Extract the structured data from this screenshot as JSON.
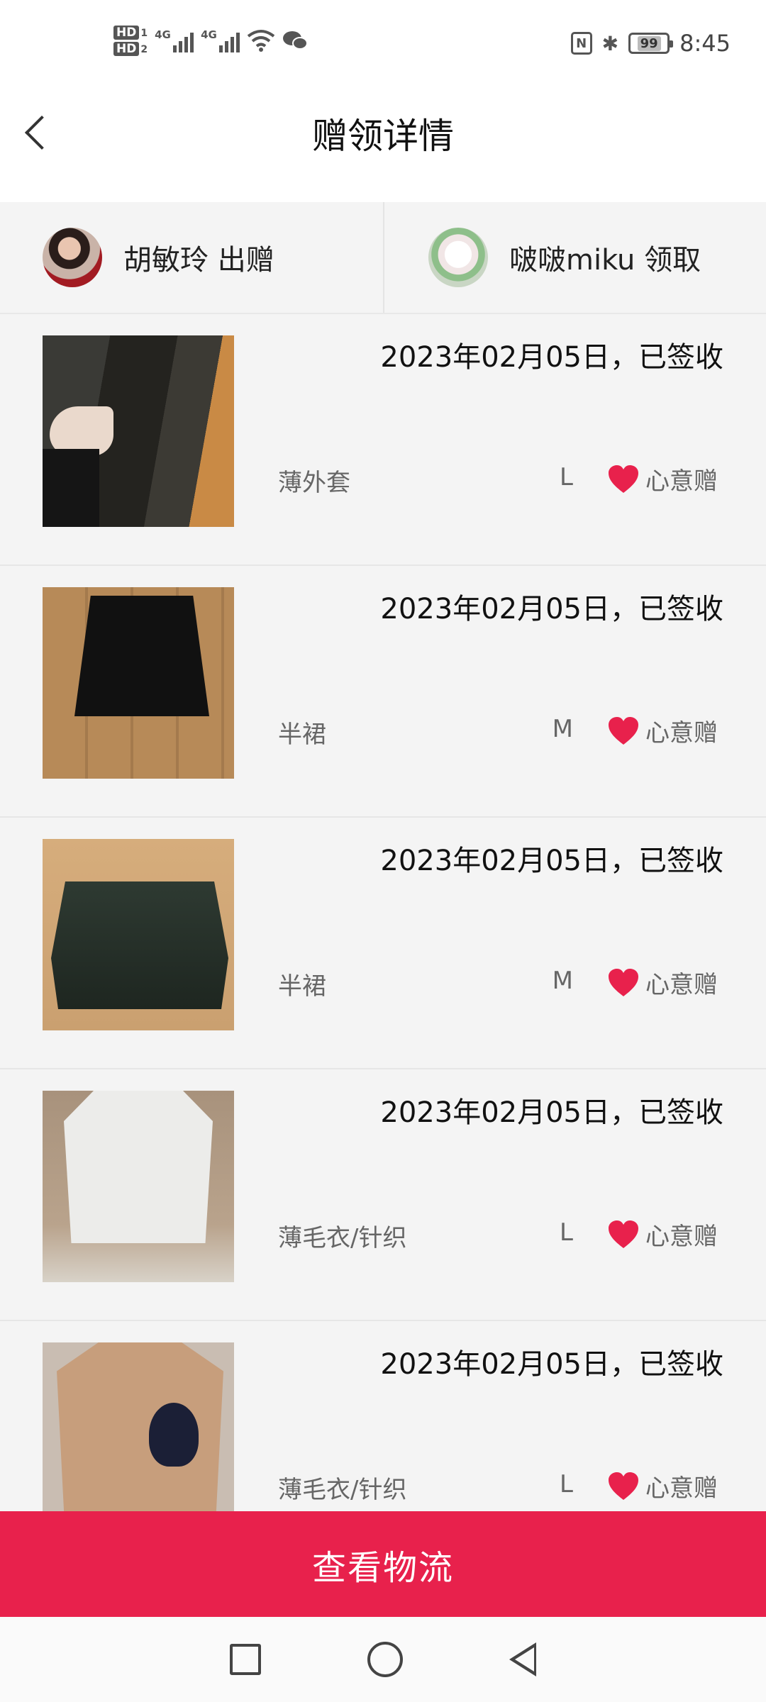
{
  "status_bar": {
    "hd1": "HD",
    "hd1_num": "1",
    "hd2": "HD",
    "hd2_num": "2",
    "sig1_tag": "4G",
    "sig2_tag": "4G",
    "nfc": "N",
    "bluetooth": "✱",
    "battery": "99",
    "time": "8:45"
  },
  "header": {
    "title": "赠领详情"
  },
  "users": {
    "giver": {
      "text": "胡敏玲 出赠"
    },
    "receiver": {
      "text": "啵啵miku 领取"
    }
  },
  "items": [
    {
      "date_status": "2023年02月05日，已签收",
      "category": "薄外套",
      "size": "L",
      "gift_label": "心意赠"
    },
    {
      "date_status": "2023年02月05日，已签收",
      "category": "半裙",
      "size": "M",
      "gift_label": "心意赠"
    },
    {
      "date_status": "2023年02月05日，已签收",
      "category": "半裙",
      "size": "M",
      "gift_label": "心意赠"
    },
    {
      "date_status": "2023年02月05日，已签收",
      "category": "薄毛衣/针织",
      "size": "L",
      "gift_label": "心意赠"
    },
    {
      "date_status": "2023年02月05日，已签收",
      "category": "薄毛衣/针织",
      "size": "L",
      "gift_label": "心意赠"
    }
  ],
  "actions": {
    "logistics": "查看物流"
  },
  "colors": {
    "accent": "#e8214c",
    "heart": "#e8214c"
  }
}
